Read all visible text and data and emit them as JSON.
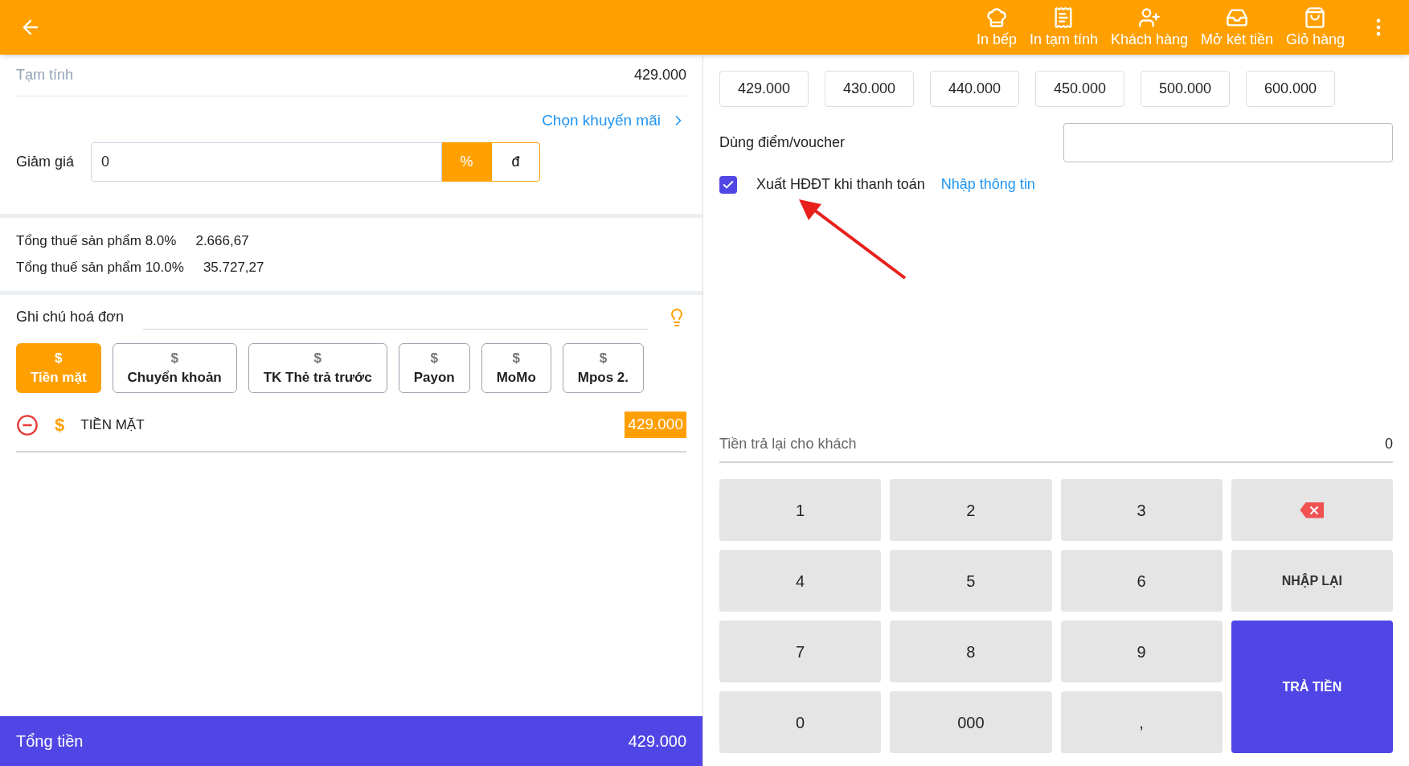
{
  "toolbar": {
    "actions": [
      {
        "kind": "kitchen",
        "label": "In bếp"
      },
      {
        "kind": "receipt",
        "label": "In tạm tính"
      },
      {
        "kind": "customer",
        "label": "Khách hàng"
      },
      {
        "kind": "drawer",
        "label": "Mở két tiền"
      },
      {
        "kind": "cart",
        "label": "Giỏ hàng"
      }
    ]
  },
  "subtotal": {
    "label": "Tạm tính",
    "value": "429.000"
  },
  "promotion_link": "Chọn khuyến mãi",
  "discount": {
    "label": "Giảm giá",
    "value": "0",
    "units": [
      {
        "label": "%",
        "selected": true
      },
      {
        "label": "đ",
        "selected": false
      }
    ]
  },
  "taxes": [
    {
      "label": "Tổng thuế sản phẩm 8.0%",
      "value": "2.666,67"
    },
    {
      "label": "Tổng thuế sản phẩm 10.0%",
      "value": "35.727,27"
    }
  ],
  "note": {
    "label": "Ghi chú hoá đơn"
  },
  "payment_methods": [
    {
      "icon": "$",
      "label": "Tiền mặt",
      "selected": true
    },
    {
      "icon": "$",
      "label": "Chuyển khoản",
      "selected": false
    },
    {
      "icon": "$",
      "label": "TK Thẻ trả trước",
      "selected": false
    },
    {
      "icon": "$",
      "label": "Payon",
      "selected": false
    },
    {
      "icon": "$",
      "label": "MoMo",
      "selected": false
    },
    {
      "icon": "$",
      "label": "Mpos 2.",
      "selected": false
    }
  ],
  "payment_line": {
    "icon": "$",
    "label": "TIỀN MẶT",
    "amount": "429.000"
  },
  "total": {
    "label": "Tổng tiền",
    "value": "429.000"
  },
  "quick_amounts": [
    "429.000",
    "430.000",
    "440.000",
    "450.000",
    "500.000",
    "600.000"
  ],
  "voucher": {
    "label": "Dùng điểm/voucher"
  },
  "e_invoice": {
    "label": "Xuất HĐĐT khi thanh toán",
    "checked": true,
    "link": "Nhập thông tin"
  },
  "change": {
    "label": "Tiền trả lại cho khách",
    "value": "0"
  },
  "keypad": [
    {
      "kind": "digit",
      "label": "1"
    },
    {
      "kind": "digit",
      "label": "2"
    },
    {
      "kind": "digit",
      "label": "3"
    },
    {
      "kind": "backspace"
    },
    {
      "kind": "digit",
      "label": "4"
    },
    {
      "kind": "digit",
      "label": "5"
    },
    {
      "kind": "digit",
      "label": "6"
    },
    {
      "kind": "reset",
      "label": "NHẬP LẠI"
    },
    {
      "kind": "digit",
      "label": "7"
    },
    {
      "kind": "digit",
      "label": "8"
    },
    {
      "kind": "digit",
      "label": "9"
    },
    {
      "kind": "pay",
      "label": "TRẢ TIỀN"
    },
    {
      "kind": "digit",
      "label": "0"
    },
    {
      "kind": "digit",
      "label": "000"
    },
    {
      "kind": "digit",
      "label": ","
    }
  ]
}
